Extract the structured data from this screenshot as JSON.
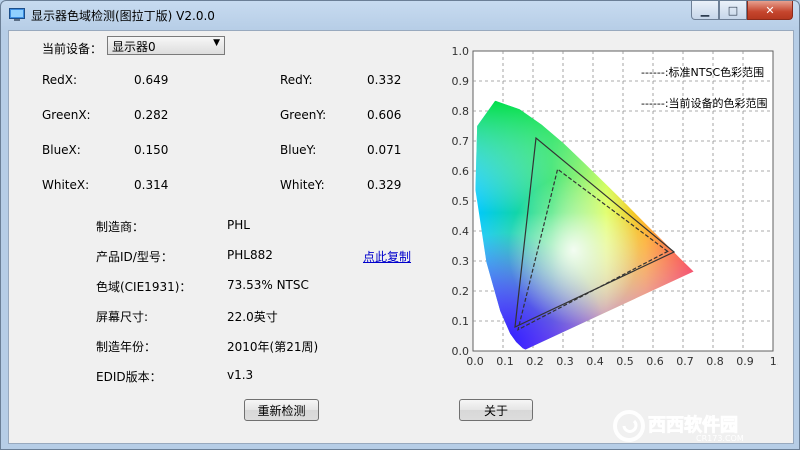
{
  "window": {
    "title": "显示器色域检测(图拉丁版) V2.0.0"
  },
  "device": {
    "label": "当前设备：",
    "selected": "显示器0"
  },
  "coords": [
    {
      "xlabel": "RedX:",
      "xvalue": "0.649",
      "ylabel": "RedY:",
      "yvalue": "0.332"
    },
    {
      "xlabel": "GreenX:",
      "xvalue": "0.282",
      "ylabel": "GreenY:",
      "yvalue": "0.606"
    },
    {
      "xlabel": "BlueX:",
      "xvalue": "0.150",
      "ylabel": "BlueY:",
      "yvalue": "0.071"
    },
    {
      "xlabel": "WhiteX:",
      "xvalue": "0.314",
      "ylabel": "WhiteY:",
      "yvalue": "0.329"
    }
  ],
  "info": [
    {
      "label": "制造商：",
      "value": "PHL"
    },
    {
      "label": "产品ID/型号：",
      "value": "PHL882"
    },
    {
      "label": "色域(CIE1931)：",
      "value": "73.53% NTSC"
    },
    {
      "label": "屏幕尺寸:",
      "value": "22.0英寸"
    },
    {
      "label": "制造年份：",
      "value": "2010年(第21周)"
    },
    {
      "label": "EDID版本：",
      "value": "v1.3"
    }
  ],
  "copy_link": "点此复制",
  "buttons": {
    "recheck": "重新检测",
    "about": "关于"
  },
  "watermark": {
    "brand": "西西软件园",
    "url": "CR173.COM"
  },
  "chart_data": {
    "type": "line",
    "xlim": [
      0,
      1
    ],
    "ylim": [
      0,
      1
    ],
    "x_ticks": [
      "0.0",
      "0.1",
      "0.2",
      "0.3",
      "0.4",
      "0.5",
      "0.6",
      "0.7",
      "0.8",
      "0.9",
      "1."
    ],
    "y_ticks": [
      "0.0",
      "0.1",
      "0.2",
      "0.3",
      "0.4",
      "0.5",
      "0.6",
      "0.7",
      "0.8",
      "0.9",
      "1.0"
    ],
    "grid": true,
    "legend_position": "top-right",
    "series": [
      {
        "name": ":标准NTSC色彩范围",
        "style": "solid",
        "points": [
          [
            0.67,
            0.33
          ],
          [
            0.21,
            0.71
          ],
          [
            0.14,
            0.08
          ]
        ]
      },
      {
        "name": ":当前设备的色彩范围",
        "style": "dashed",
        "points": [
          [
            0.649,
            0.332
          ],
          [
            0.282,
            0.606
          ],
          [
            0.15,
            0.071
          ]
        ]
      }
    ],
    "legend_labels": [
      "------:标准NTSC色彩范围",
      "------:当前设备的色彩范围"
    ],
    "locus": [
      [
        0.175,
        0.005
      ],
      [
        0.166,
        0.009
      ],
      [
        0.144,
        0.03
      ],
      [
        0.124,
        0.058
      ],
      [
        0.091,
        0.133
      ],
      [
        0.045,
        0.295
      ],
      [
        0.008,
        0.538
      ],
      [
        0.014,
        0.75
      ],
      [
        0.074,
        0.834
      ],
      [
        0.155,
        0.806
      ],
      [
        0.229,
        0.754
      ],
      [
        0.302,
        0.692
      ],
      [
        0.373,
        0.624
      ],
      [
        0.444,
        0.555
      ],
      [
        0.513,
        0.487
      ],
      [
        0.575,
        0.424
      ],
      [
        0.627,
        0.373
      ],
      [
        0.665,
        0.334
      ],
      [
        0.691,
        0.308
      ],
      [
        0.735,
        0.265
      ]
    ],
    "colors": {
      "red": "#ff2020",
      "green": "#00d040",
      "blue": "#3050ff",
      "grid": "#909090"
    }
  }
}
